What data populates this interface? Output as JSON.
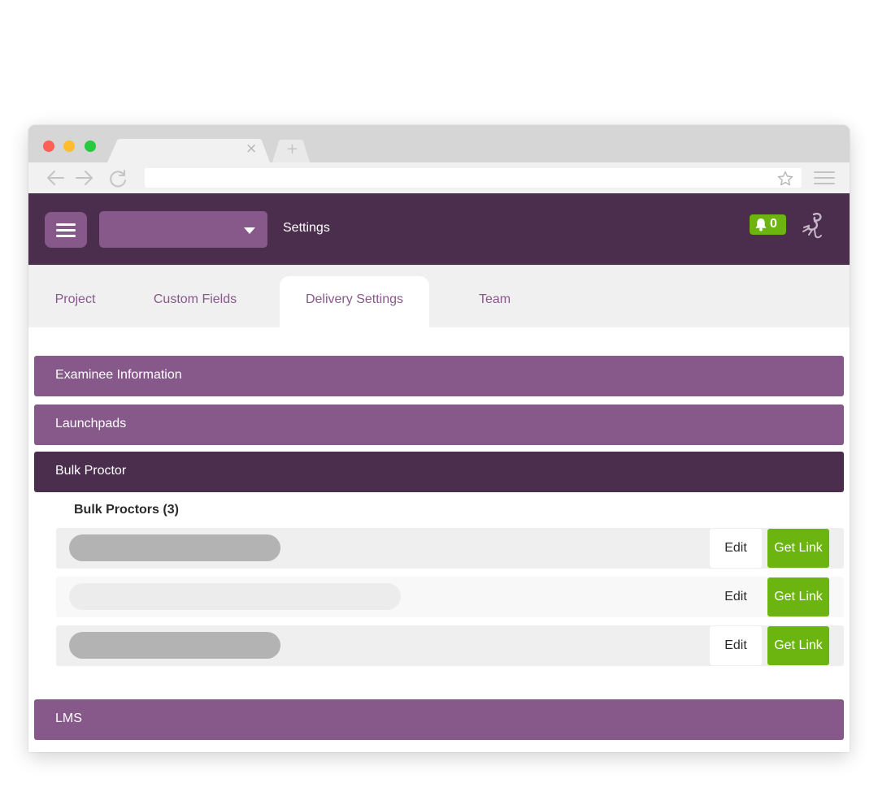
{
  "browser": {
    "tab_close_glyph": "×",
    "new_tab_glyph": "+",
    "address_value": ""
  },
  "header": {
    "project_select_value": "",
    "page_title": "Settings",
    "notification_count": "0"
  },
  "tabs": [
    {
      "label": "Project",
      "active": false
    },
    {
      "label": "Custom Fields",
      "active": false
    },
    {
      "label": "Delivery Settings",
      "active": true
    },
    {
      "label": "Team",
      "active": false
    }
  ],
  "sections": [
    {
      "label": "Examinee Information",
      "expanded": false
    },
    {
      "label": "Launchpads",
      "expanded": false
    },
    {
      "label": "Bulk Proctor",
      "expanded": true
    },
    {
      "label": "LMS",
      "expanded": false
    }
  ],
  "bulk_proctors": {
    "heading": "Bulk Proctors (3)",
    "rows": [
      {
        "name": "",
        "edit_label": "Edit",
        "link_label": "Get Link"
      },
      {
        "name": "",
        "edit_label": "Edit",
        "link_label": "Get Link"
      },
      {
        "name": "",
        "edit_label": "Edit",
        "link_label": "Get Link"
      }
    ]
  },
  "colors": {
    "brand_dark": "#4b2d4d",
    "brand_light": "#87598a",
    "accent_green": "#6cb510"
  }
}
